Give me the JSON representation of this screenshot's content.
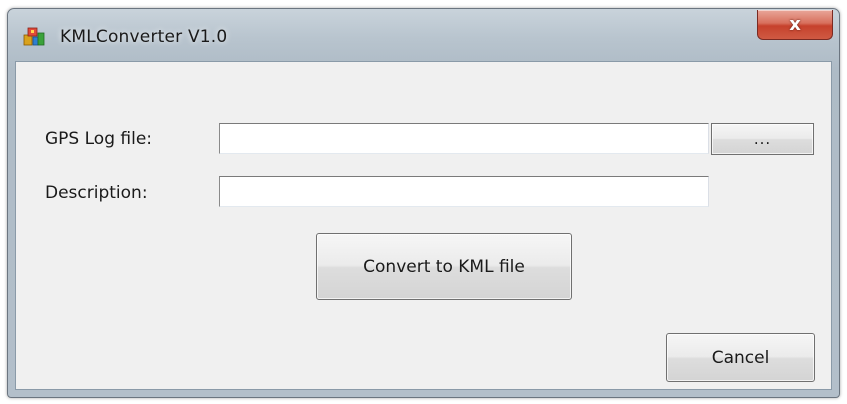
{
  "window": {
    "title": "KMLConverter V1.0",
    "close_label": "x",
    "app_icon": "kml-app-icon"
  },
  "form": {
    "gps_log_label": "GPS Log file:",
    "gps_log_value": "",
    "browse_label": "...",
    "description_label": "Description:",
    "description_value": "",
    "convert_label": "Convert to KML file",
    "cancel_label": "Cancel"
  },
  "colors": {
    "close_button": "#c6412c",
    "client_background": "#f0f0f0"
  }
}
